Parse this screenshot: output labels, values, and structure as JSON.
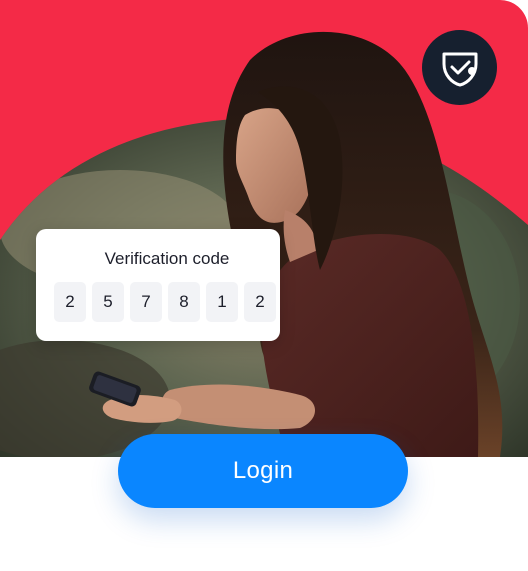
{
  "verification": {
    "title": "Verification code",
    "digits": [
      "2",
      "5",
      "7",
      "8",
      "1",
      "2"
    ]
  },
  "login_button": {
    "label": "Login"
  },
  "colors": {
    "brand_red": "#f42a47",
    "button_blue": "#0a86ff",
    "badge_navy": "#16202f"
  },
  "icons": {
    "badge": "shield-check-icon"
  }
}
